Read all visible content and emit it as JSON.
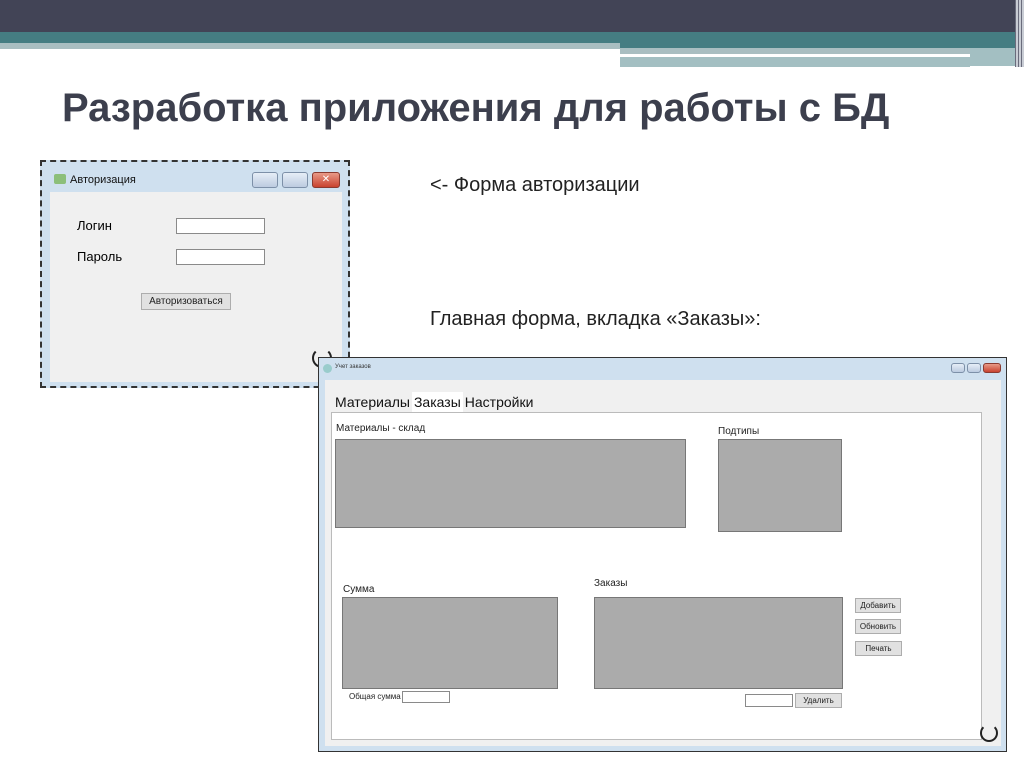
{
  "slide": {
    "title": "Разработка приложения для работы с БД",
    "caption_auth": "<- Форма авторизации",
    "caption_main": "Главная форма, вкладка «Заказы»:"
  },
  "auth_form": {
    "title": "Авторизация",
    "login_label": "Логин",
    "password_label": "Пароль",
    "login_value": "",
    "password_value": "",
    "submit": "Авторизоваться"
  },
  "main_form": {
    "title": "Учет заказов",
    "tabs": [
      "Материалы",
      "Заказы",
      "Настройки"
    ],
    "active_tab": "Заказы",
    "materials_label": "Материалы - склад",
    "subtypes_label": "Подтипы",
    "sum_label": "Сумма",
    "orders_label": "Заказы",
    "total_label": "Общая сумма",
    "total_value": "",
    "delete_value": "",
    "buttons": {
      "add": "Добавить",
      "refresh": "Обновить",
      "print": "Печать",
      "delete": "Удалить"
    }
  },
  "colors": {
    "header": "#424456",
    "accent": "#457d82",
    "grid": "#ababab"
  }
}
